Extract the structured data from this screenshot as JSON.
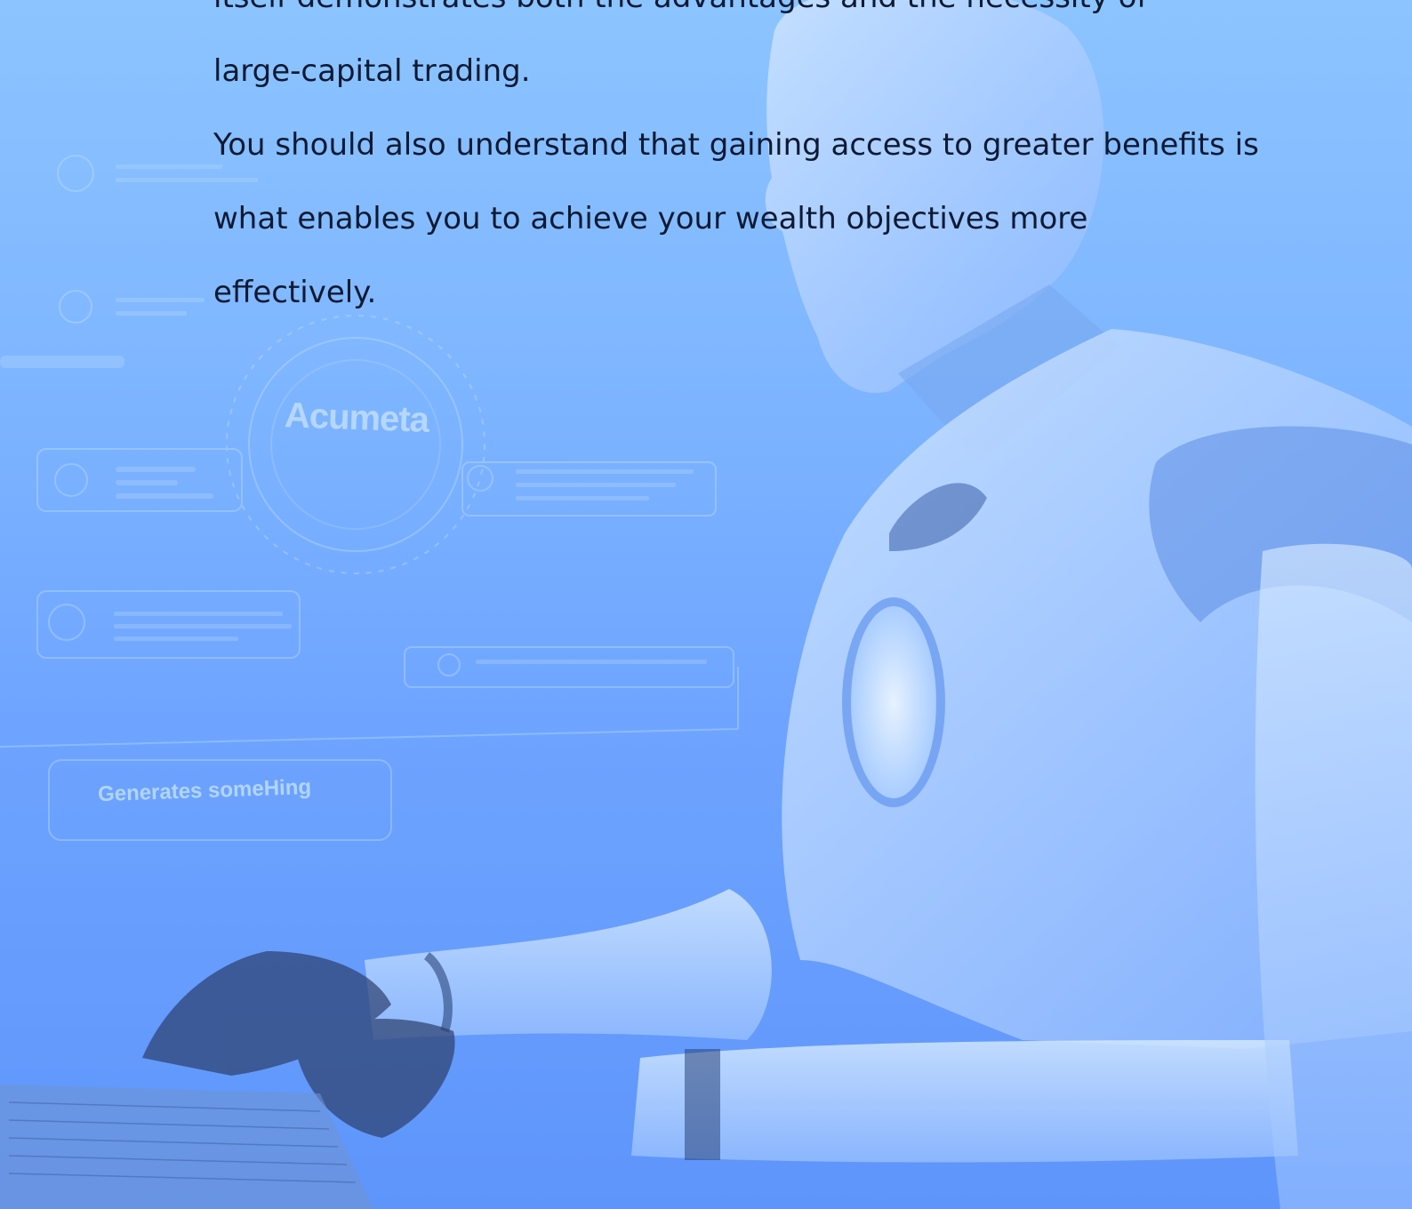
{
  "paragraphs": [
    {
      "lines": [
        "itself demonstrates both the advantages and the necessity of",
        "large-capital trading."
      ]
    },
    {
      "lines": [
        "You should also understand that gaining access to greater benefits is",
        "what enables you to achieve your wealth objectives more",
        "effectively."
      ]
    }
  ],
  "hud": {
    "logo_text": "Acumeta",
    "panel_label": "Generates someHing"
  },
  "colors": {
    "background_top": "#8cc4ff",
    "background_bottom": "#5e95fb",
    "text": "#0d1a33"
  }
}
